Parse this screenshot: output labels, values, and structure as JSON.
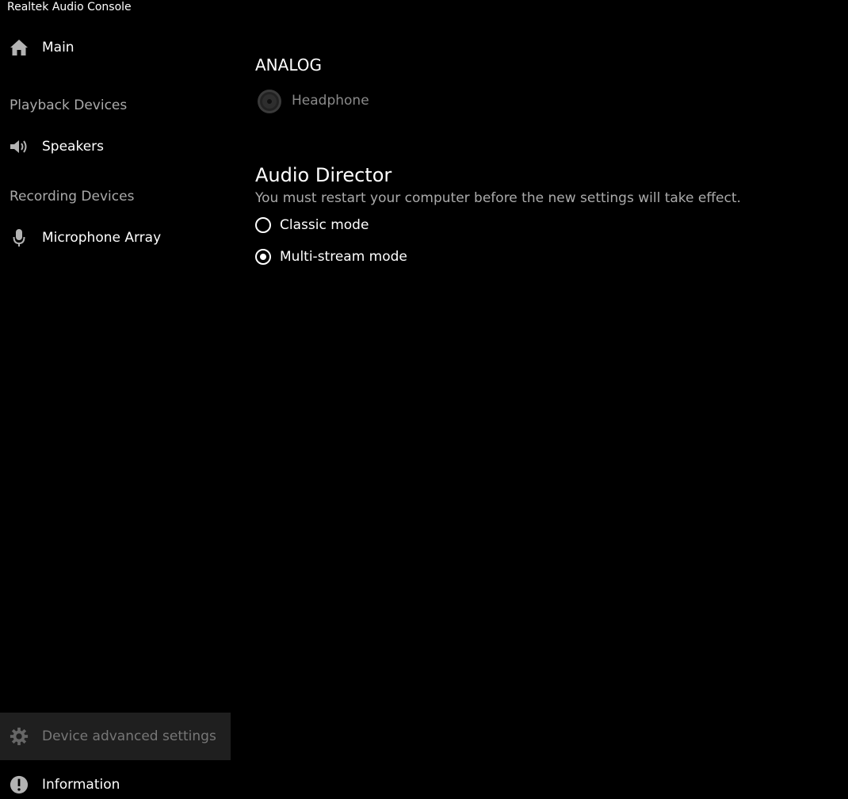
{
  "window": {
    "title": "Realtek Audio Console"
  },
  "sidebar": {
    "main": {
      "label": "Main",
      "icon": "home-icon"
    },
    "playback_header": "Playback Devices",
    "speakers": {
      "label": "Speakers",
      "icon": "speaker-icon"
    },
    "recording_header": "Recording Devices",
    "microphone": {
      "label": "Microphone Array",
      "icon": "microphone-icon"
    },
    "advanced": {
      "label": "Device advanced settings",
      "icon": "gear-icon"
    },
    "information": {
      "label": "Information",
      "icon": "info-icon"
    }
  },
  "main": {
    "analog_heading": "ANALOG",
    "analog_device": {
      "label": "Headphone",
      "icon": "headphone-jack-icon"
    },
    "audio_director": {
      "heading": "Audio Director",
      "description": "You must restart your computer before the new settings will take effect.",
      "options": [
        {
          "label": "Classic mode",
          "selected": false
        },
        {
          "label": "Multi-stream mode",
          "selected": true
        }
      ]
    }
  },
  "colors": {
    "background": "#000000",
    "selected_item_bg": "#1f1f1f",
    "secondary_text": "#aaaaaa"
  }
}
